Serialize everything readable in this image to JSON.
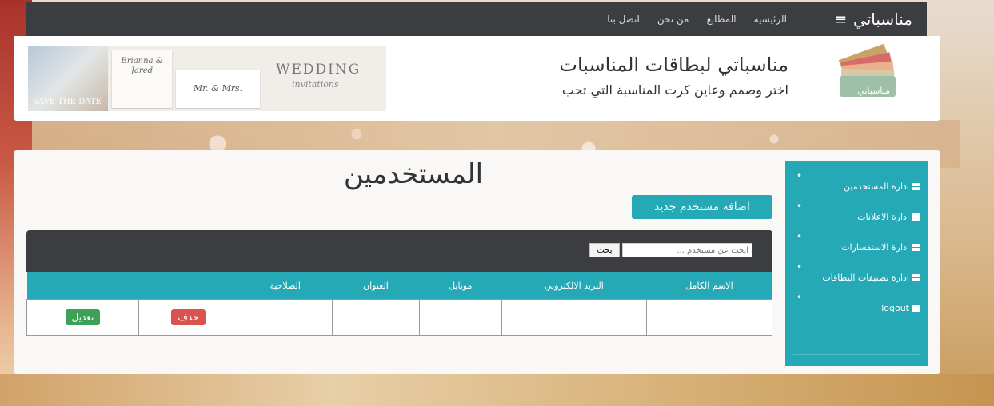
{
  "nav": {
    "brand": "مناسباتي",
    "menu_icon": "hamburger-icon",
    "links": [
      "الرئيسية",
      "المطابع",
      "من نحن",
      "اتصل بنا"
    ]
  },
  "header": {
    "title": "مناسباتي لبطاقات المناسبات",
    "subtitle": "اختر وصمم وعاين كرت المناسبة التي تحب",
    "logo_text": "مناسباتي",
    "banner": {
      "photo_text": "SAVE THE DATE",
      "card1": "Brianna & Jared",
      "card2": "Mr. & Mrs.",
      "title": "WEDDING",
      "subtitle": "invitations"
    }
  },
  "sidebar": {
    "items": [
      {
        "label": "ادارة المستخدمين"
      },
      {
        "label": "ادارة الاعلانات"
      },
      {
        "label": "ادارة الاستفسارات"
      },
      {
        "label": "ادارة تصنيفات البطاقات"
      },
      {
        "label": "logout"
      }
    ]
  },
  "main": {
    "title": "المستخدمين",
    "add_button": "اضافة مستخدم جديد",
    "search_placeholder": "ابحث عن مستخدم ...",
    "search_button": "بحث",
    "table": {
      "headers": [
        "الاسم الكامل",
        "البريد الالكتروني",
        "موبايل",
        "العنوان",
        "الصلاحية",
        "",
        ""
      ],
      "delete_label": "حذف",
      "edit_label": "تعديل"
    }
  },
  "colors": {
    "nav_bg": "#3b3d40",
    "accent": "#26a9b6",
    "delete": "#d9534f",
    "edit": "#3ca155"
  }
}
